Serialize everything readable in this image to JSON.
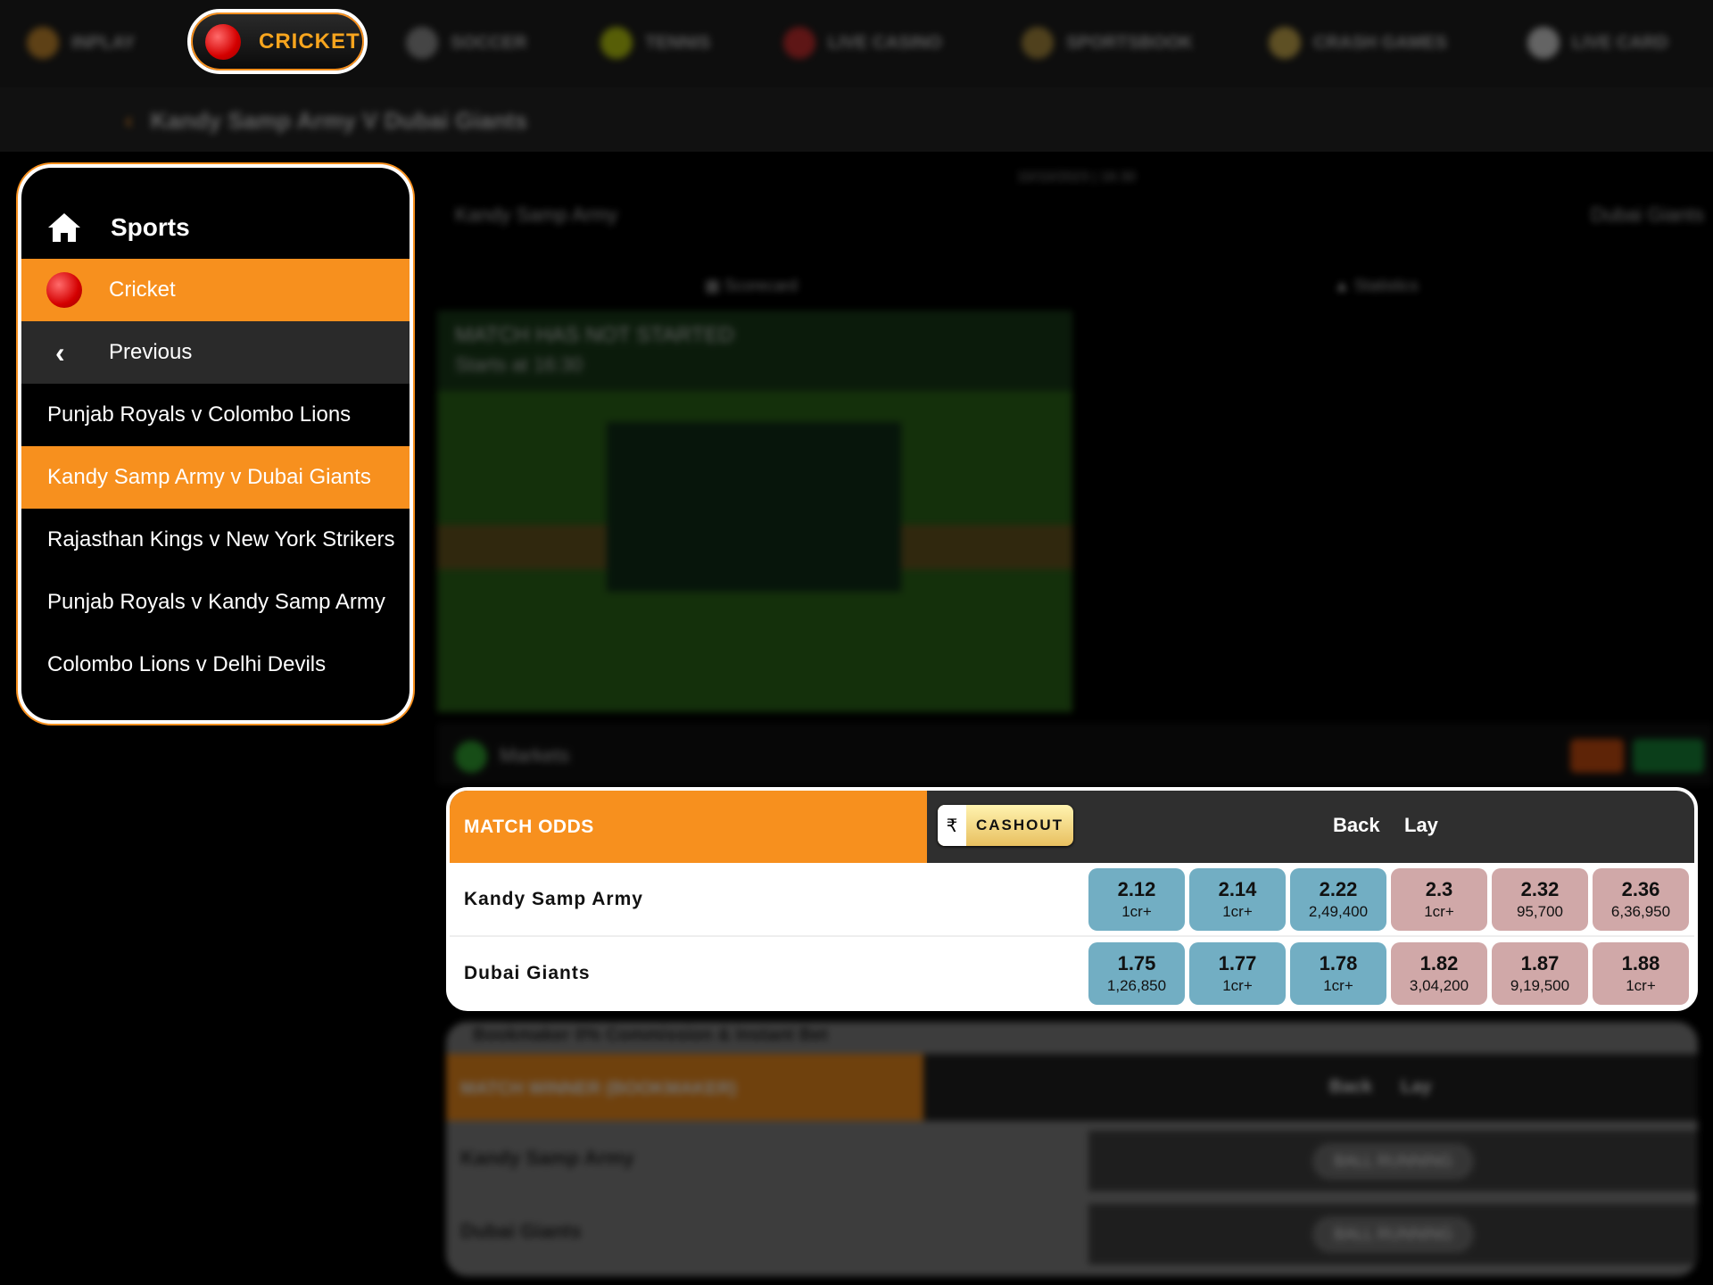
{
  "nav": {
    "items": [
      {
        "label": "INPLAY",
        "icon": "inplay-icon",
        "color": "#c08020"
      },
      {
        "label": "CRICKET",
        "icon": "cricket-ball-icon",
        "color": "#e00000",
        "active": true
      },
      {
        "label": "SOCCER",
        "icon": "soccer-ball-icon",
        "color": "#888888"
      },
      {
        "label": "TENNIS",
        "icon": "tennis-ball-icon",
        "color": "#b0c000"
      },
      {
        "label": "LIVE CASINO",
        "icon": "dice-icon",
        "color": "#c02020"
      },
      {
        "label": "SPORTSBOOK",
        "icon": "shield-icon",
        "color": "#a08030"
      },
      {
        "label": "CRASH GAMES",
        "icon": "rocket-icon",
        "color": "#c0a040"
      },
      {
        "label": "LIVE CARD",
        "icon": "card-icon",
        "color": "#cccccc"
      }
    ]
  },
  "breadcrumb": {
    "title": "Kandy Samp Army V Dubai Giants"
  },
  "sidebar": {
    "header": "Sports",
    "sport": "Cricket",
    "previous": "Previous",
    "matches": [
      "Punjab Royals v Colombo Lions",
      "Kandy Samp Army v Dubai Giants",
      "Rajasthan Kings v New York Strikers",
      "Punjab Royals v Kandy Samp Army",
      "Colombo Lions v Delhi Devils"
    ],
    "active_match": 1
  },
  "match": {
    "date": "10/10/2023 | 16:30",
    "team1": "Kandy Samp Army",
    "team2": "Dubai Giants",
    "tab_scorecard": "Scorecard",
    "tab_statistics": "Statistics",
    "status": "MATCH HAS NOT STARTED",
    "starts": "Starts at 16:30",
    "markets": "Markets"
  },
  "match_odds": {
    "title": "MATCH ODDS",
    "cashout": "CASHOUT",
    "currency": "₹",
    "back": "Back",
    "lay": "Lay",
    "runners": [
      {
        "name": "Kandy Samp Army",
        "back": [
          {
            "p": "2.12",
            "s": "1cr+"
          },
          {
            "p": "2.14",
            "s": "1cr+"
          },
          {
            "p": "2.22",
            "s": "2,49,400"
          }
        ],
        "lay": [
          {
            "p": "2.3",
            "s": "1cr+"
          },
          {
            "p": "2.32",
            "s": "95,700"
          },
          {
            "p": "2.36",
            "s": "6,36,950"
          }
        ]
      },
      {
        "name": "Dubai Giants",
        "back": [
          {
            "p": "1.75",
            "s": "1,26,850"
          },
          {
            "p": "1.77",
            "s": "1cr+"
          },
          {
            "p": "1.78",
            "s": "1cr+"
          }
        ],
        "lay": [
          {
            "p": "1.82",
            "s": "3,04,200"
          },
          {
            "p": "1.87",
            "s": "9,19,500"
          },
          {
            "p": "1.88",
            "s": "1cr+"
          }
        ]
      }
    ]
  },
  "bookmaker": {
    "note": "Bookmaker 0% Commission & Instant Bet",
    "title": "MATCH WINNER (BOOKMAKER)",
    "back": "Back",
    "lay": "Lay",
    "status": "BALL RUNNING",
    "runners": [
      "Kandy Samp Army",
      "Dubai Giants"
    ]
  },
  "colors": {
    "accent": "#f7901e",
    "back": "#72aec3",
    "lay": "#d0a8a8"
  }
}
